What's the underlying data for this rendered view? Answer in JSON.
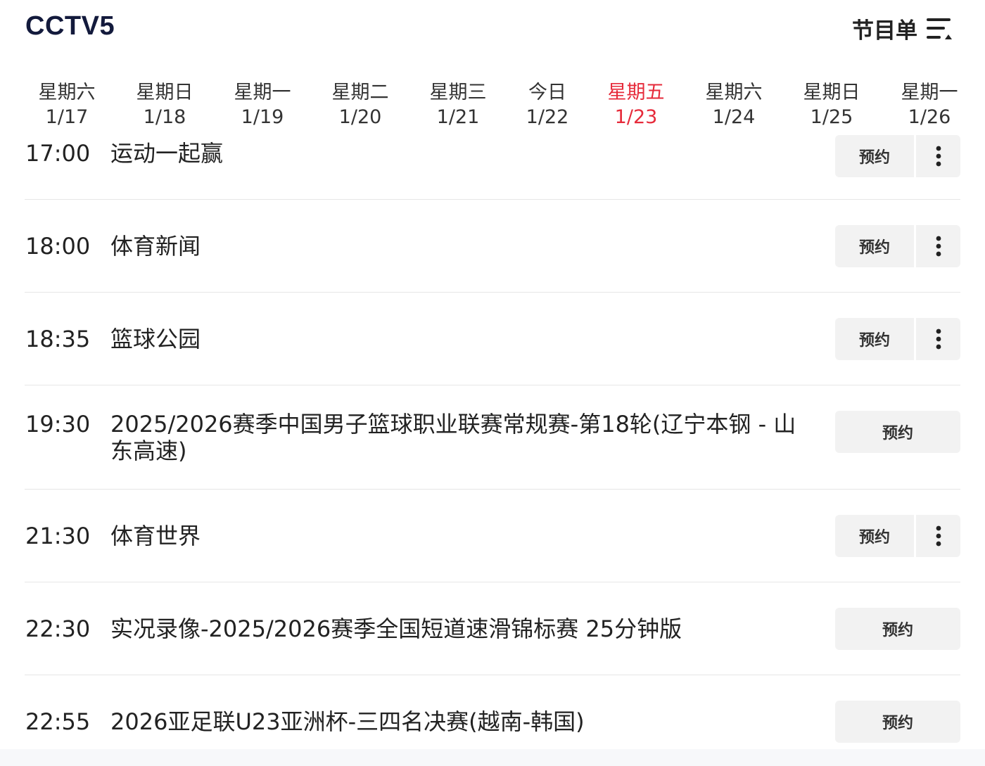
{
  "header": {
    "channel": "CCTV5",
    "menu_label": "节目单",
    "menu_icon": "list-menu-icon"
  },
  "days": [
    {
      "weekday": "星期六",
      "date": "1/17",
      "active": false
    },
    {
      "weekday": "星期日",
      "date": "1/18",
      "active": false
    },
    {
      "weekday": "星期一",
      "date": "1/19",
      "active": false
    },
    {
      "weekday": "星期二",
      "date": "1/20",
      "active": false
    },
    {
      "weekday": "星期三",
      "date": "1/21",
      "active": false
    },
    {
      "weekday": "今日",
      "date": "1/22",
      "active": false
    },
    {
      "weekday": "星期五",
      "date": "1/23",
      "active": true
    },
    {
      "weekday": "星期六",
      "date": "1/24",
      "active": false
    },
    {
      "weekday": "星期日",
      "date": "1/25",
      "active": false
    },
    {
      "weekday": "星期一",
      "date": "1/26",
      "active": false
    }
  ],
  "programs": [
    {
      "time": "17:00",
      "title": "运动一起赢",
      "reserve": "预约",
      "has_more": true
    },
    {
      "time": "18:00",
      "title": "体育新闻",
      "reserve": "预约",
      "has_more": true
    },
    {
      "time": "18:35",
      "title": "篮球公园",
      "reserve": "预约",
      "has_more": true
    },
    {
      "time": "19:30",
      "title": "2025/2026赛季中国男子篮球职业联赛常规赛-第18轮(辽宁本钢 - 山东高速)",
      "reserve": "预约",
      "has_more": false
    },
    {
      "time": "21:30",
      "title": "体育世界",
      "reserve": "预约",
      "has_more": true
    },
    {
      "time": "22:30",
      "title": "实况录像-2025/2026赛季全国短道速滑锦标赛 25分钟版",
      "reserve": "预约",
      "has_more": false
    },
    {
      "time": "22:55",
      "title": "2026亚足联U23亚洲杯-三四名决赛(越南-韩国)",
      "reserve": "预约",
      "has_more": false
    }
  ],
  "colors": {
    "active_day": "#e62a3a",
    "channel_title": "#131a3c",
    "button_bg": "#f2f2f2"
  }
}
